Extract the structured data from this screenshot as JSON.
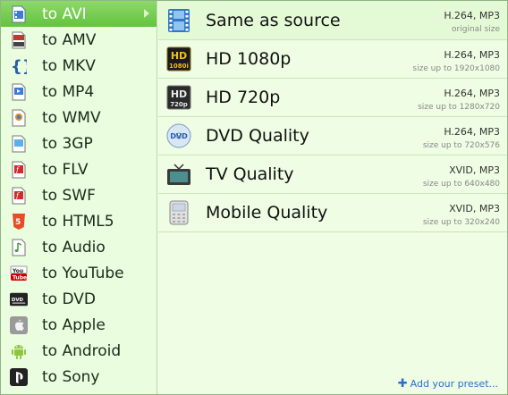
{
  "menu": {
    "items": [
      {
        "label": "to AVI",
        "icon": "avi-file-icon",
        "color": "#3d7bd9"
      },
      {
        "label": "to AMV",
        "icon": "amv-file-icon",
        "color": "#c0392b"
      },
      {
        "label": "to MKV",
        "icon": "mkv-icon",
        "color": "#2a5fa8"
      },
      {
        "label": "to MP4",
        "icon": "mp4-file-icon",
        "color": "#3d7bd9"
      },
      {
        "label": "to WMV",
        "icon": "wmv-file-icon",
        "color": "#e08a1e"
      },
      {
        "label": "to 3GP",
        "icon": "3gp-file-icon",
        "color": "#3d9ad9"
      },
      {
        "label": "to FLV",
        "icon": "flv-file-icon",
        "color": "#d12b2b"
      },
      {
        "label": "to SWF",
        "icon": "swf-file-icon",
        "color": "#d12b2b"
      },
      {
        "label": "to HTML5",
        "icon": "html5-icon",
        "color": "#e44d26"
      },
      {
        "label": "to Audio",
        "icon": "audio-file-icon",
        "color": "#4a9a3a"
      },
      {
        "label": "to YouTube",
        "icon": "youtube-icon",
        "color": "#cc0000"
      },
      {
        "label": "to DVD",
        "icon": "dvd-icon",
        "color": "#222222"
      },
      {
        "label": "to Apple",
        "icon": "apple-icon",
        "color": "#777777"
      },
      {
        "label": "to Android",
        "icon": "android-icon",
        "color": "#8cc63f"
      },
      {
        "label": "to Sony",
        "icon": "playstation-icon",
        "color": "#222222"
      }
    ],
    "selected_index": 0
  },
  "presets": {
    "items": [
      {
        "name": "Same as source",
        "codec": "H.264, MP3",
        "size": "original size",
        "icon": "film-icon"
      },
      {
        "name": "HD 1080p",
        "codec": "H.264, MP3",
        "size": "size up to 1920x1080",
        "icon": "hd-1080i-icon",
        "badge": "HD",
        "badge_sub": "1080i"
      },
      {
        "name": "HD 720p",
        "codec": "H.264, MP3",
        "size": "size up to 1280x720",
        "icon": "hd-720p-icon",
        "badge": "HD",
        "badge_sub": "720p"
      },
      {
        "name": "DVD Quality",
        "codec": "H.264, MP3",
        "size": "size up to 720x576",
        "icon": "dvd-disc-icon",
        "badge": "DVD"
      },
      {
        "name": "TV Quality",
        "codec": "XVID, MP3",
        "size": "size up to 640x480",
        "icon": "tv-icon"
      },
      {
        "name": "Mobile Quality",
        "codec": "XVID, MP3",
        "size": "size up to 320x240",
        "icon": "mobile-phone-icon"
      }
    ],
    "add_label": "Add your preset..."
  },
  "colors": {
    "selected_bg": "#6ccb45",
    "panel_bg": "#eefde3",
    "link": "#2a6fd0"
  }
}
